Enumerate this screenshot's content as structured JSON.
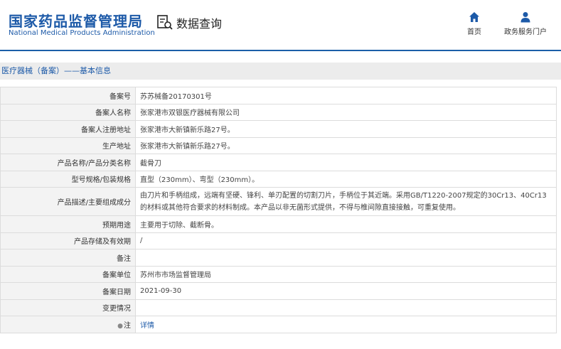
{
  "header": {
    "logo_cn": "国家药品监督管理局",
    "logo_en": "National Medical Products Administration",
    "query_title": "数据查询",
    "nav": {
      "home": "首页",
      "gov": "政务服务门户"
    }
  },
  "breadcrumb": "医疗器械（备案）——基本信息",
  "rows": [
    {
      "label": "备案号",
      "value": "苏苏械备20170301号"
    },
    {
      "label": "备案人名称",
      "value": "张家港市双银医疗器械有限公司"
    },
    {
      "label": "备案人注册地址",
      "value": "张家港市大新镇新乐路27号。"
    },
    {
      "label": "生产地址",
      "value": "张家港市大新镇新乐路27号。"
    },
    {
      "label": "产品名称/产品分类名称",
      "value": "截骨刀"
    },
    {
      "label": "型号规格/包装规格",
      "value": "直型（230mm）、弯型（230mm）。"
    },
    {
      "label": "产品描述/主要组成成分",
      "value": "由刀片和手柄组成，远端有坚硬、锋利、单刃配置的切割刀片，手柄位于其近端。采用GB/T1220-2007规定的30Cr13、40Cr13的材料或其他符合要求的材料制成。本产品以非无菌形式提供，不得与椎间隙直接接触，可重复使用。"
    },
    {
      "label": "预期用途",
      "value": "主要用于切除、截断骨。"
    },
    {
      "label": "产品存储及有效期",
      "value": "/"
    },
    {
      "label": "备注",
      "value": ""
    },
    {
      "label": "备案单位",
      "value": "苏州市市场监督管理局"
    },
    {
      "label": "备案日期",
      "value": "2021-09-30"
    },
    {
      "label": "变更情况",
      "value": ""
    },
    {
      "label": "注",
      "value": "详情"
    }
  ],
  "colors": {
    "brand": "#1d5aa8",
    "label_bg": "#f3f3f3",
    "border": "#dcdcdc"
  }
}
